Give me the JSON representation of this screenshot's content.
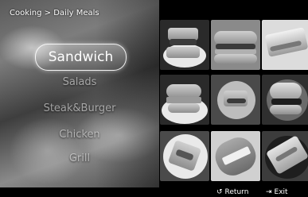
{
  "breadcrumb": "Cooking > Daily Meals",
  "menu": {
    "selected": "Sandwich",
    "items": [
      "Salads",
      "Steak&Burger",
      "Chicken",
      "Grill"
    ]
  },
  "footer": {
    "return_label": "Return",
    "exit_label": "Exit",
    "return_icon": "↺",
    "exit_icon": "⇥"
  }
}
